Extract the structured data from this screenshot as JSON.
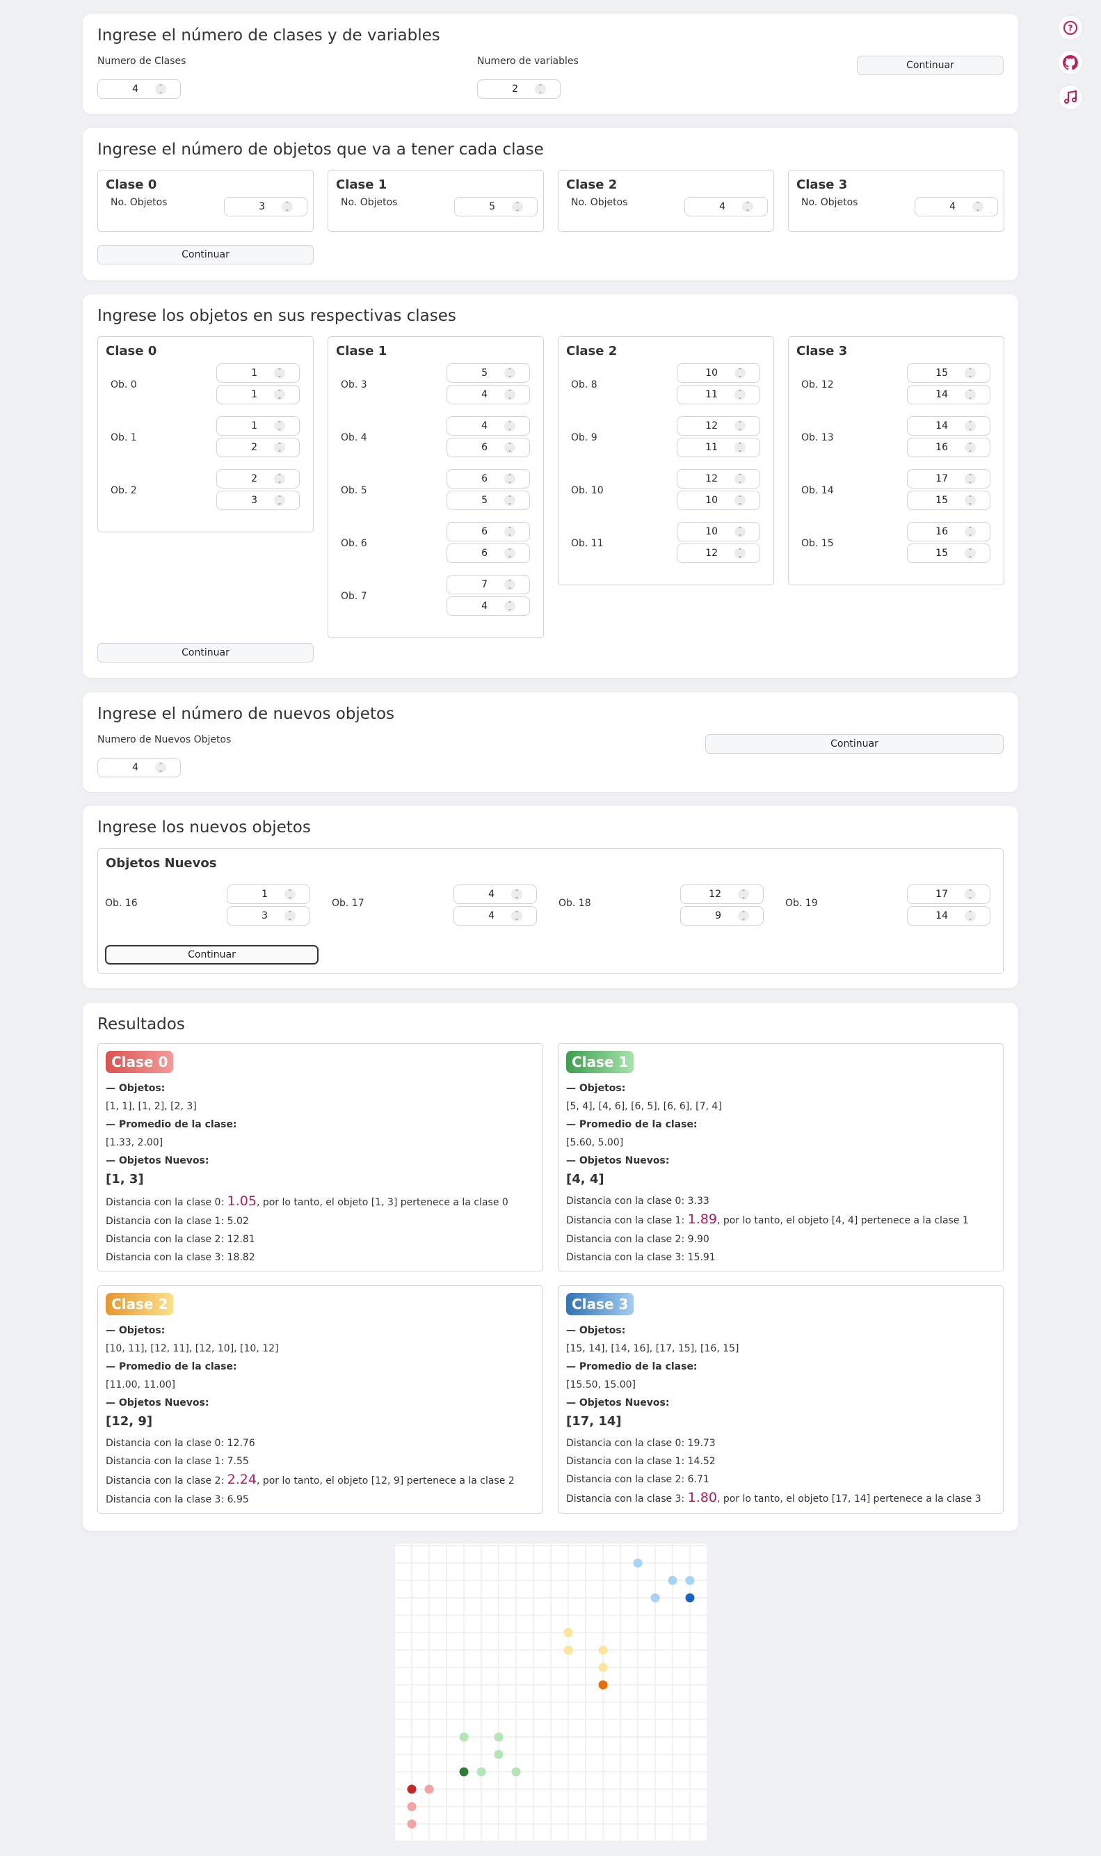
{
  "side_icons": [
    "help-circle-icon",
    "github-icon",
    "music-note-icon"
  ],
  "step1": {
    "title": "Ingrese el número de clases y de variables",
    "classes_label": "Numero de Clases",
    "classes_value": "4",
    "vars_label": "Numero de variables",
    "vars_value": "2",
    "continue": "Continuar"
  },
  "step2": {
    "title": "Ingrese el número de objetos que va a tener cada clase",
    "objects_label": "No. Objetos",
    "continue": "Continuar",
    "classes": [
      {
        "name": "Clase 0",
        "count": "3"
      },
      {
        "name": "Clase 1",
        "count": "5"
      },
      {
        "name": "Clase 2",
        "count": "4"
      },
      {
        "name": "Clase 3",
        "count": "4"
      }
    ]
  },
  "step3": {
    "title": "Ingrese los objetos en sus respectivas clases",
    "continue": "Continuar",
    "classes": [
      {
        "name": "Clase 0",
        "objects": [
          {
            "label": "Ob. 0",
            "v": [
              "1",
              "1"
            ]
          },
          {
            "label": "Ob. 1",
            "v": [
              "1",
              "2"
            ]
          },
          {
            "label": "Ob. 2",
            "v": [
              "2",
              "3"
            ]
          }
        ]
      },
      {
        "name": "Clase 1",
        "objects": [
          {
            "label": "Ob. 3",
            "v": [
              "5",
              "4"
            ]
          },
          {
            "label": "Ob. 4",
            "v": [
              "4",
              "6"
            ]
          },
          {
            "label": "Ob. 5",
            "v": [
              "6",
              "5"
            ]
          },
          {
            "label": "Ob. 6",
            "v": [
              "6",
              "6"
            ]
          },
          {
            "label": "Ob. 7",
            "v": [
              "7",
              "4"
            ]
          }
        ]
      },
      {
        "name": "Clase 2",
        "objects": [
          {
            "label": "Ob. 8",
            "v": [
              "10",
              "11"
            ]
          },
          {
            "label": "Ob. 9",
            "v": [
              "12",
              "11"
            ]
          },
          {
            "label": "Ob. 10",
            "v": [
              "12",
              "10"
            ]
          },
          {
            "label": "Ob. 11",
            "v": [
              "10",
              "12"
            ]
          }
        ]
      },
      {
        "name": "Clase 3",
        "objects": [
          {
            "label": "Ob. 12",
            "v": [
              "15",
              "14"
            ]
          },
          {
            "label": "Ob. 13",
            "v": [
              "14",
              "16"
            ]
          },
          {
            "label": "Ob. 14",
            "v": [
              "17",
              "15"
            ]
          },
          {
            "label": "Ob. 15",
            "v": [
              "16",
              "15"
            ]
          }
        ]
      }
    ]
  },
  "step4": {
    "title": "Ingrese el número de nuevos objetos",
    "label": "Numero de Nuevos Objetos",
    "value": "4",
    "continue": "Continuar"
  },
  "step5": {
    "title": "Ingrese los nuevos objetos",
    "box_title": "Objetos Nuevos",
    "continue": "Continuar",
    "objects": [
      {
        "label": "Ob. 16",
        "v": [
          "1",
          "3"
        ]
      },
      {
        "label": "Ob. 17",
        "v": [
          "4",
          "4"
        ]
      },
      {
        "label": "Ob. 18",
        "v": [
          "12",
          "9"
        ]
      },
      {
        "label": "Ob. 19",
        "v": [
          "17",
          "14"
        ]
      }
    ]
  },
  "results": {
    "title": "Resultados",
    "objects_hdr": "— Objetos:",
    "mean_hdr": "— Promedio de la clase:",
    "new_hdr": "— Objetos Nuevos:",
    "classes": [
      {
        "badge": "Clase 0",
        "color_from": "#d9534f",
        "color_to": "#f49b9b",
        "objects": "[1, 1], [1, 2], [2, 3]",
        "mean": "[1.33, 2.00]",
        "new": "[1, 3]",
        "distances": [
          {
            "pre": "Distancia con la clase 0: ",
            "val": "1.05",
            "post": ", por lo tanto, el objeto [1, 3] pertenece a la clase 0",
            "hl": true
          },
          {
            "pre": "Distancia con la clase 1: ",
            "val": "5.02",
            "post": "",
            "hl": false
          },
          {
            "pre": "Distancia con la clase 2: ",
            "val": "12.81",
            "post": "",
            "hl": false
          },
          {
            "pre": "Distancia con la clase 3: ",
            "val": "18.82",
            "post": "",
            "hl": false
          }
        ]
      },
      {
        "badge": "Clase 1",
        "color_from": "#3e9e4f",
        "color_to": "#a6e3ac",
        "objects": "[5, 4], [4, 6], [6, 5], [6, 6], [7, 4]",
        "mean": "[5.60, 5.00]",
        "new": "[4, 4]",
        "distances": [
          {
            "pre": "Distancia con la clase 0: ",
            "val": "3.33",
            "post": "",
            "hl": false
          },
          {
            "pre": "Distancia con la clase 1: ",
            "val": "1.89",
            "post": ", por lo tanto, el objeto [4, 4] pertenece a la clase 1",
            "hl": true
          },
          {
            "pre": "Distancia con la clase 2: ",
            "val": "9.90",
            "post": "",
            "hl": false
          },
          {
            "pre": "Distancia con la clase 3: ",
            "val": "15.91",
            "post": "",
            "hl": false
          }
        ]
      },
      {
        "badge": "Clase 2",
        "color_from": "#e8962e",
        "color_to": "#fbe18a",
        "objects": "[10, 11], [12, 11], [12, 10], [10, 12]",
        "mean": "[11.00, 11.00]",
        "new": "[12, 9]",
        "distances": [
          {
            "pre": "Distancia con la clase 0: ",
            "val": "12.76",
            "post": "",
            "hl": false
          },
          {
            "pre": "Distancia con la clase 1: ",
            "val": "7.55",
            "post": "",
            "hl": false
          },
          {
            "pre": "Distancia con la clase 2: ",
            "val": "2.24",
            "post": ", por lo tanto, el objeto [12, 9] pertenece a la clase 2",
            "hl": true
          },
          {
            "pre": "Distancia con la clase 3: ",
            "val": "6.95",
            "post": "",
            "hl": false
          }
        ]
      },
      {
        "badge": "Clase 3",
        "color_from": "#2f73b5",
        "color_to": "#a3cdf2",
        "objects": "[15, 14], [14, 16], [17, 15], [16, 15]",
        "mean": "[15.50, 15.00]",
        "new": "[17, 14]",
        "distances": [
          {
            "pre": "Distancia con la clase 0: ",
            "val": "19.73",
            "post": "",
            "hl": false
          },
          {
            "pre": "Distancia con la clase 1: ",
            "val": "14.52",
            "post": "",
            "hl": false
          },
          {
            "pre": "Distancia con la clase 2: ",
            "val": "6.71",
            "post": "",
            "hl": false
          },
          {
            "pre": "Distancia con la clase 3: ",
            "val": "1.80",
            "post": ", por lo tanto, el objeto [17, 14] pertenece a la clase 3",
            "hl": true
          }
        ]
      }
    ]
  },
  "chart_data": {
    "type": "scatter",
    "grid": true,
    "xlim": [
      0,
      18
    ],
    "ylim": [
      0,
      17
    ],
    "series": [
      {
        "class": 0,
        "color": "#f4a3a3",
        "points": [
          [
            1,
            1
          ],
          [
            1,
            2
          ],
          [
            2,
            3
          ]
        ]
      },
      {
        "class": 0,
        "color": "#c62828",
        "points": [
          [
            1,
            3
          ]
        ],
        "new": true
      },
      {
        "class": 1,
        "color": "#b3e6b5",
        "points": [
          [
            5,
            4
          ],
          [
            4,
            6
          ],
          [
            6,
            5
          ],
          [
            6,
            6
          ],
          [
            7,
            4
          ]
        ]
      },
      {
        "class": 1,
        "color": "#2e7d32",
        "points": [
          [
            4,
            4
          ]
        ],
        "new": true
      },
      {
        "class": 2,
        "color": "#fde49a",
        "points": [
          [
            10,
            11
          ],
          [
            12,
            11
          ],
          [
            12,
            10
          ],
          [
            10,
            12
          ]
        ]
      },
      {
        "class": 2,
        "color": "#ef6c00",
        "points": [
          [
            12,
            9
          ]
        ],
        "new": true
      },
      {
        "class": 3,
        "color": "#a9d3f5",
        "points": [
          [
            15,
            14
          ],
          [
            14,
            16
          ],
          [
            17,
            15
          ],
          [
            16,
            15
          ]
        ]
      },
      {
        "class": 3,
        "color": "#1565c0",
        "points": [
          [
            17,
            14
          ]
        ],
        "new": true
      }
    ]
  }
}
